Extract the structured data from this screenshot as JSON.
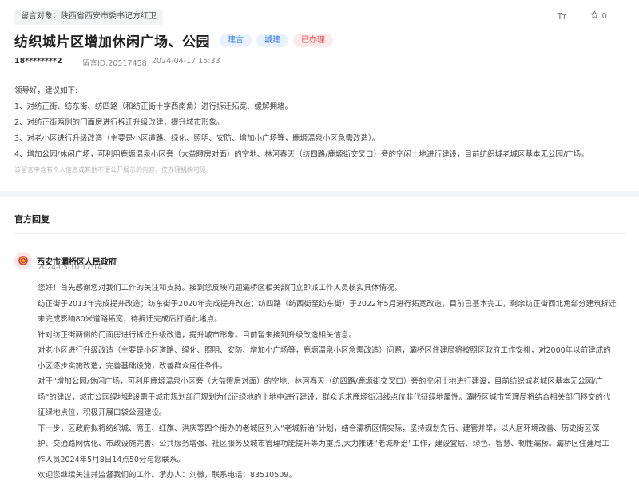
{
  "header": {
    "target_tag": "留言对象：陕西省西安市委书记方红卫",
    "font_size_icon": "Tт",
    "favorite_count": "0"
  },
  "post": {
    "title": "纺织城片区增加休闲广场、公园",
    "badges": [
      "建言",
      "城建",
      "已办理"
    ],
    "user": "18********2",
    "message_id": "留言ID:20517458",
    "datetime": "2024-04-17 15:33",
    "body": [
      "领导好，建议如下:",
      "1、对纺正街、纺东街、纺四路（和纺正街十字西南角）进行拆迁拓宽、缓解拥堵。",
      "2、对纺正街两侧的门面房进行拆迁升级改建，提升城市形象。",
      "3、对老小区进行升级改造（主要是小区道路、绿化、照明、安防、增加小广场等，鹿塬温泉小区急需改造）。",
      "4、增加公园/休闲广场，可利用鹿塬温泉小区旁（大益瞪房对面）的空地、林河春天（纺四路/鹿塬街交叉口）旁的空闲土地进行建设，目前纺织城老城区基本无公园/广场。"
    ],
    "disclaimer": "该留言中含有个人信息或其他不便公开展示的内容，仅办理机构可见。"
  },
  "reply": {
    "heading": "官方回复",
    "org": "西安市灞桥区人民政府",
    "datetime": "2024-05-10 17:14",
    "body": [
      "您好！首先感谢您对我们工作的关注和支持。接到您反映问题灞桥区相关部门立即派工作人员核实具体情况。",
      "纺正街于2013年完成提升改造；纺东街于2020年完成提升改造；纺四路（纺西街至纺东街）于2022年5月进行拓宽改造，目前已基本完工，剩余纺正街西北角部分建筑拆迁",
      "未完成影响80米道路拓宽，待拆迁完成后打通此堵点。",
      "针对纺正街两侧的门面房进行拆迁升级改造，提升城市形象。目前暂未接到升级改造相关信息。",
      "对老小区进行升级改造（主要是小区道路、绿化、照明、安防、增加小广场等，鹿塬温泉小区急需改造）问题，灞桥区住建局将按照区政府工作安排，对2000年以前建成的",
      "小区逐步实施改造，完善基础设施，改善群众居住条件。",
      "对于“增加公园/休闲广场，可利用鹿塬温泉小区旁（大益瞪房对面）的空地、林河春天（纺四路/鹿塬街交叉口）旁的空闲土地进行建设，目前纺织城老城区基本无公园/广",
      "场”的建议，城市公园绿地建设需于城市规划部门规划为代征绿地的土地中进行建设，群众诉求鹿塬街沿线点位非代征绿地属性。灞桥区城市管理局将结合相关部门移交的代",
      "征绿地点位，积极开展口袋公园建设。",
      "下一步，区政府拟将纺织城、席王、红旗、洪庆等四个街办的老城区列入“老城新治”计划，结合灞桥区情实际，坚持规划先行、建管并举，以人居环境改善、历史街区保",
      "护、交通路网优化、市政设施完善、公共服务增强、社区服务及城市管理功能提升等为重点,大力推进“老城新治”工作，建设宜居、绿色、智慧、韧性灞桥。灞桥区住建局工",
      "作人员2024年5月8日14点50分与您联系。",
      "欢迎您继续关注并监督我们的工作。承办人：刘徽，联系电话：83510509。"
    ]
  },
  "colors": {
    "badge_blue_text": "#3b7ddd",
    "badge_red_text": "#e04848",
    "divider": "#f3f4f6"
  }
}
